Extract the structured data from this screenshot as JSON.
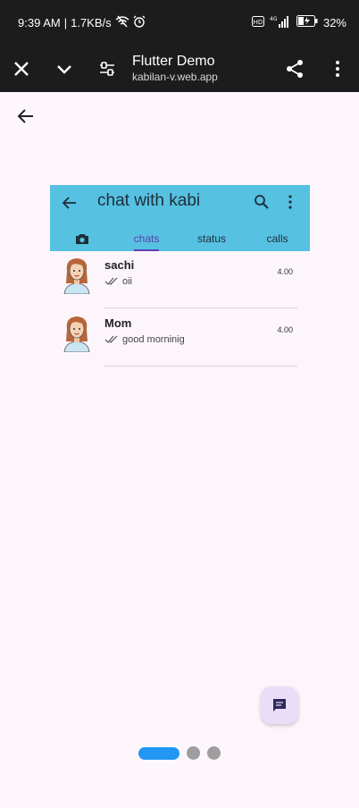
{
  "status_bar": {
    "time": "9:39 AM",
    "speed": "1.7KB/s",
    "battery": "32%",
    "network_label": "4G"
  },
  "browser": {
    "title": "Flutter Demo",
    "url": "kabilan-v.web.app"
  },
  "app": {
    "title": "chat with kabi",
    "tabs": [
      {
        "label": ""
      },
      {
        "label": "chats"
      },
      {
        "label": "status"
      },
      {
        "label": "calls"
      }
    ],
    "chats": [
      {
        "name": "sachi",
        "message": "oii",
        "time": "4.00"
      },
      {
        "name": "Mom",
        "message": "good morninig",
        "time": "4.00"
      }
    ]
  },
  "colors": {
    "app_bar": "#56c1e0",
    "active_tab": "#5b3fb0",
    "page_dot_active": "#2196f3",
    "fab": "#e9ddf8"
  },
  "icons": [
    "close-icon",
    "chevron-down-icon",
    "page-settings-icon",
    "share-icon",
    "more-vert-icon",
    "back-arrow-icon",
    "search-icon",
    "camera-icon",
    "double-check-icon",
    "chat-icon"
  ]
}
